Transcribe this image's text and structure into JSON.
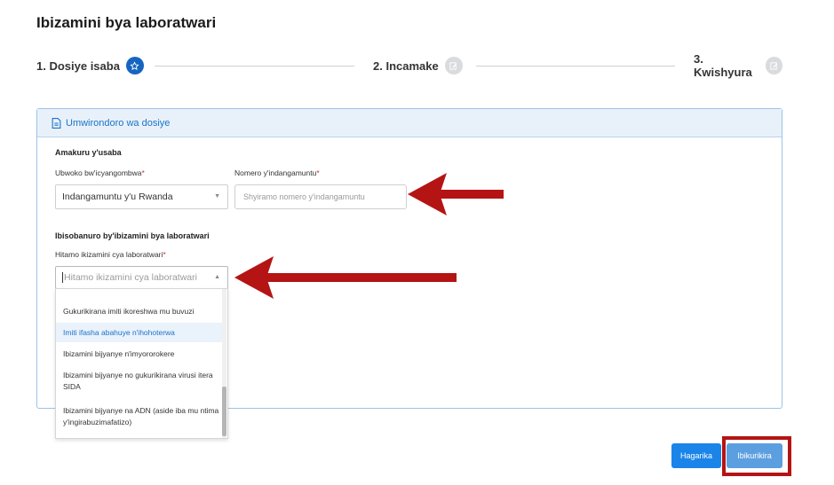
{
  "page": {
    "title": "Ibizamini bya laboratwari"
  },
  "stepper": {
    "steps": [
      {
        "label": "1. Dosiye isaba",
        "icon": "star-icon",
        "state": "active"
      },
      {
        "label": "2. Incamake",
        "icon": "edit-icon",
        "state": "inactive"
      },
      {
        "label": "3. Kwishyura",
        "icon": "edit-icon",
        "state": "inactive"
      }
    ]
  },
  "card": {
    "header": "Umwirondoro wa dosiye",
    "header_icon": "document-icon",
    "applicant_section": "Amakuru y'usaba",
    "id_type": {
      "label": "Ubwoko bw'icyangombwa",
      "required_mark": "*",
      "value": "Indangamuntu y'u Rwanda"
    },
    "id_number": {
      "label": "Nomero y'indangamuntu",
      "required_mark": "*",
      "placeholder": "Shyiramo nomero y'indangamuntu"
    },
    "lab_section": "Ibisobanuro by'ibizamini bya laboratwari",
    "lab_test": {
      "label": "Hitamo ikizamini cya laboratwari",
      "required_mark": "*",
      "placeholder": "Hitamo ikizamini cya laboratwari"
    }
  },
  "dropdown": {
    "options": [
      "Gukurikirana imiti ikoreshwa mu buvuzi",
      "Imiti ifasha abahuye n'ihohoterwa",
      "Ibizamini bijyanye n'imyororokere",
      "Ibizamini bijyanye no gukurikirana virusi itera SIDA",
      "Ibizamini bijyanye na ADN (aside iba mu ntima y'ingirabuzimafatizo)"
    ],
    "highlighted_index": 1
  },
  "buttons": {
    "back": "Hagarika",
    "next": "Ibikurikira"
  },
  "colors": {
    "primary": "#1565c0",
    "annotation": "#b51414"
  }
}
